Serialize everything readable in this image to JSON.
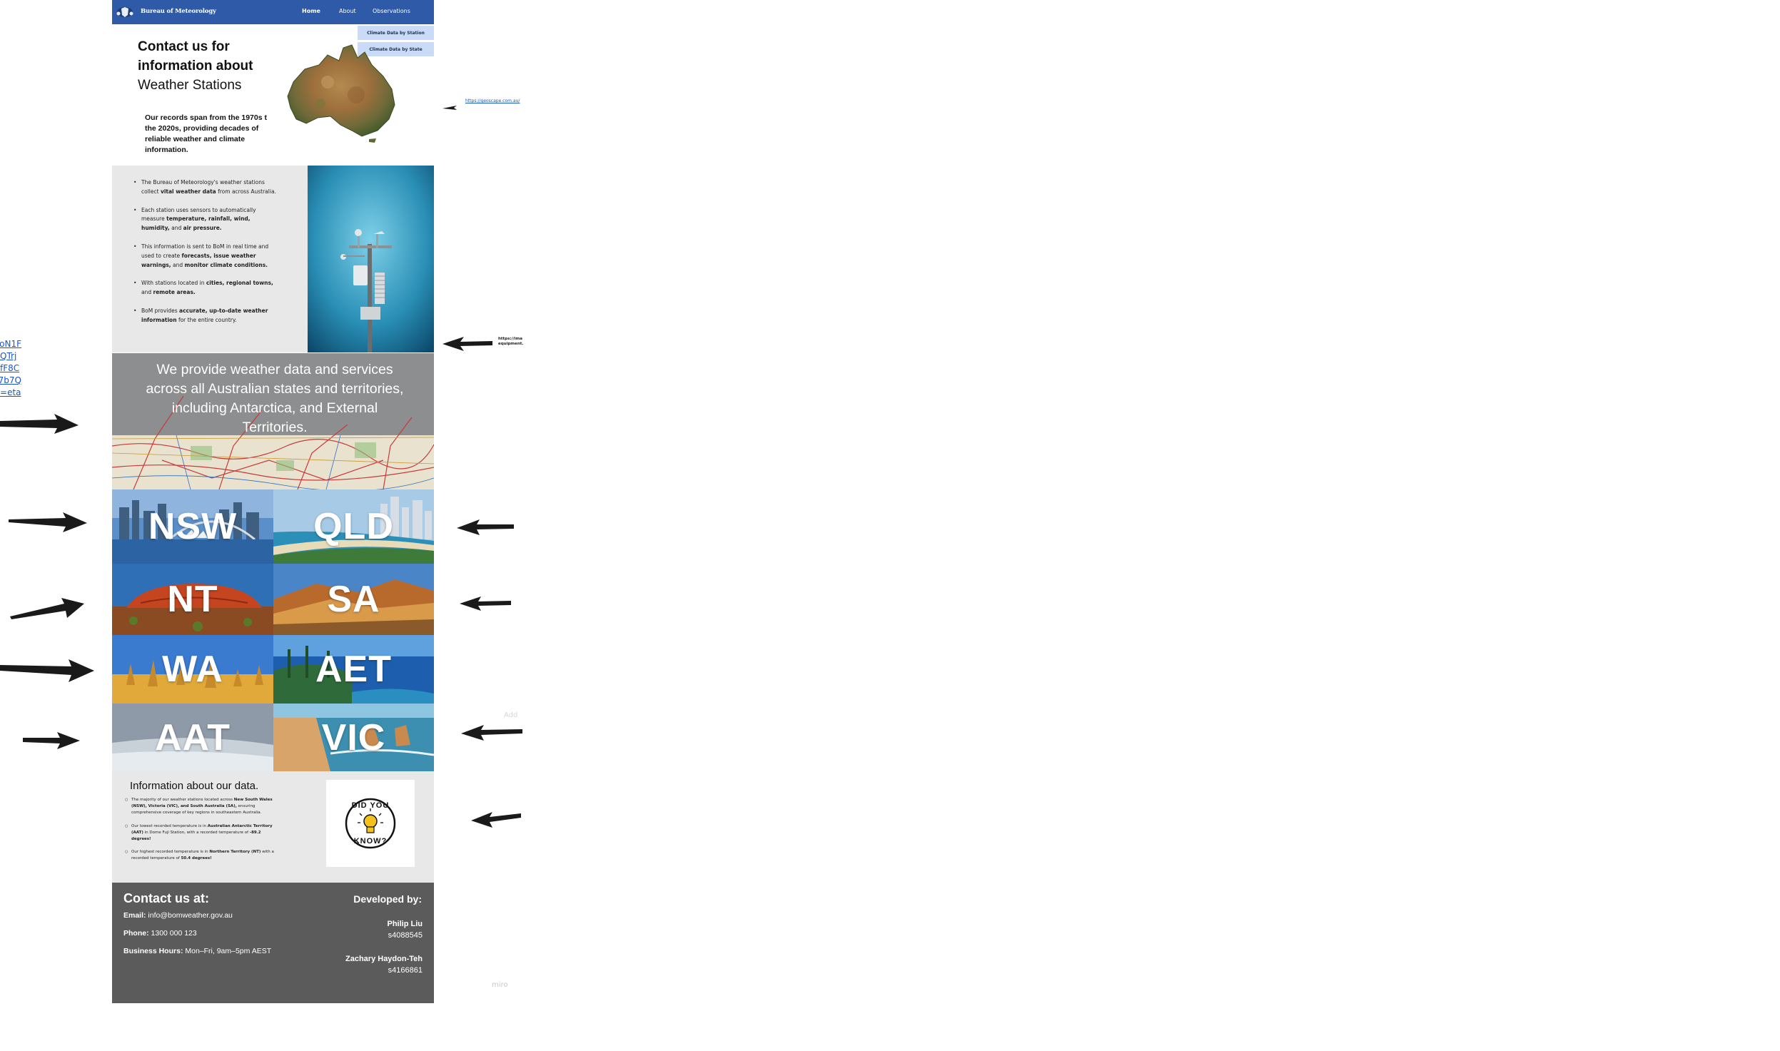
{
  "nav": {
    "brand": "Bureau of Meteorology",
    "links": [
      "Home",
      "About",
      "Observations"
    ],
    "dropdown": [
      "Climate Data by Station",
      "Climate Data by State"
    ]
  },
  "hero": {
    "title_bold_1": "Contact us for",
    "title_bold_2": "information about",
    "title_light": "Weather Stations",
    "subtitle": "Our records span from the 1970s t\nthe 2020s, providing decades of\nreliable weather and climate\ninformation."
  },
  "info_points": [
    [
      "The Bureau of Meteorology's weather stations collect ",
      "vital weather data",
      " from across Australia."
    ],
    [
      "Each station uses sensors to automatically measure ",
      "temperature, rainfall, wind, humidity,",
      " and ",
      "air pressure."
    ],
    [
      "This information is sent to BoM in real time and used to create ",
      "forecasts, issue weather warnings,",
      " and ",
      "monitor climate conditions."
    ],
    [
      "With stations located in ",
      "cities, regional towns,",
      " and ",
      "remote areas."
    ],
    [
      "BoM provides ",
      "accurate, up-to-date weather information",
      " for the entire country."
    ]
  ],
  "map_band": {
    "text": "We provide weather data and services across all Australian states and territories, including Antarctica, and External Territories."
  },
  "states": {
    "nsw": "NSW",
    "qld": "QLD",
    "nt": "NT",
    "sa": "SA",
    "wa": "WA",
    "aet": "AET",
    "aat": "AAT",
    "vic": "VIC"
  },
  "facts": {
    "title": "Information about our data.",
    "items": [
      [
        "The majority of our weather stations located across ",
        "New South Wales (NSW), Victoria (VIC), and South Australia (SA),",
        " ensuring comprehensive coverage of key regions in southeastern Australia."
      ],
      [
        "Our lowest recorded temperature is in ",
        "Australian Antarctic Territory (AAT)",
        " in Dome Fuji Station, with a recorded temperature of ",
        "-89.2 degrees!"
      ],
      [
        "Our highest recorded temperature is in ",
        "Northern Territory (NT)",
        " with a recorded temperature of ",
        "50.4 degrees!"
      ]
    ],
    "dyk_top": "DID YOU",
    "dyk_bottom": "KNOW?"
  },
  "footer": {
    "contact_title": "Contact us at:",
    "email_label": "Email:",
    "email": " info@bomweather.gov.au",
    "phone_label": "Phone:",
    "phone": " 1300 000 123",
    "hours_label": "Business Hours:",
    "hours": " Mon–Fri, 9am–5pm AEST",
    "dev_title": "Developed by:",
    "dev1_name": "Philip Liu",
    "dev1_id": "s4088545",
    "dev2_name": "Zachary Haydon-Teh",
    "dev2_id": "s4166861"
  },
  "annotations": {
    "geo_link": "https://geoscape.com.au/",
    "img_ref_1": "https://ima",
    "img_ref_2": "equipment.",
    "left_links": [
      "oN1F",
      "QTrj",
      "fF8C",
      "7b7Q",
      "eta="
    ],
    "faint_1": "Add",
    "faint_2": "miro"
  },
  "colors": {
    "nav": "#2e5aa8",
    "dropdown": "#c9dbf7",
    "band_grey": "#e8e8e8",
    "footer": "#5b5b5b",
    "link": "#1a55c7"
  }
}
